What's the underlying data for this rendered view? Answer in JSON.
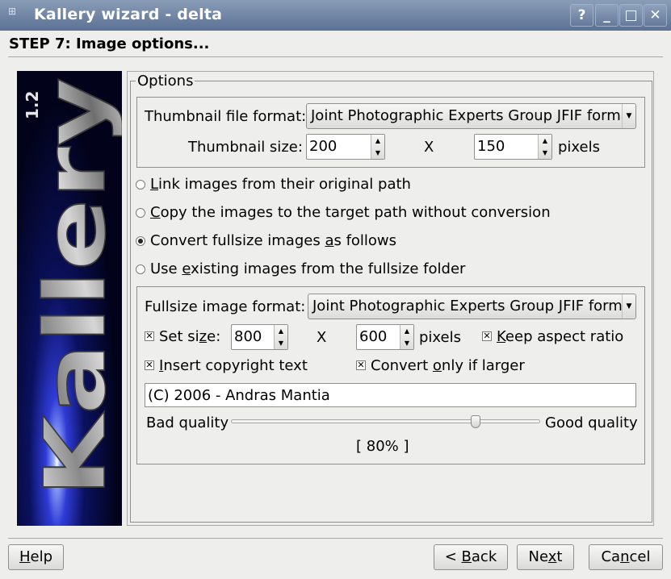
{
  "window": {
    "title": "Kallery wizard - delta",
    "help_icon": "question-mark-icon",
    "minimize_icon": "minimize-icon",
    "maximize_icon": "maximize-icon",
    "close_icon": "close-icon"
  },
  "step_title": "STEP 7: Image options...",
  "banner": {
    "logo_text": "Kallery",
    "version": "1.2"
  },
  "options": {
    "group_label": "Options",
    "thumbnail": {
      "format_label": "Thumbnail file format:",
      "format_value": "Joint Photographic Experts Group JFIF format",
      "size_label": "Thumbnail size:",
      "width": "200",
      "x_label": "X",
      "height": "150",
      "unit": "pixels"
    },
    "radios": {
      "link_pre": "",
      "link_ul": "L",
      "link_post": "ink images from their original path",
      "copy_pre": "",
      "copy_ul": "C",
      "copy_post": "opy the images to the target path without conversion",
      "convert_pre": "Convert fullsize images ",
      "convert_ul": "a",
      "convert_post": "s follows",
      "existing_pre": "Use ",
      "existing_ul": "e",
      "existing_post": "xisting images from the fullsize folder",
      "selected": "convert"
    },
    "fullsize": {
      "format_label": "Fullsize image format:",
      "format_value": "Joint Photographic Experts Group JFIF format",
      "set_size_pre": "Set si",
      "set_size_ul": "z",
      "set_size_post": "e:",
      "set_size_checked": true,
      "width": "800",
      "x_label": "X",
      "height": "600",
      "unit": "pixels",
      "keep_pre": "",
      "keep_ul": "K",
      "keep_post": "eep aspect ratio",
      "keep_checked": true,
      "copyright_pre": "",
      "copyright_ul": "I",
      "copyright_post": "nsert copyright text",
      "copyright_checked": true,
      "larger_pre": "Convert ",
      "larger_ul": "o",
      "larger_post": "nly if larger",
      "larger_checked": true,
      "copyright_text": "(C) 2006 - Andras Mantia",
      "bad_quality": "Bad quality",
      "good_quality": "Good quality",
      "quality_percent": 80,
      "quality_label": "[ 80% ]"
    }
  },
  "buttons": {
    "help_ul": "H",
    "help_post": "elp",
    "back_pre": "< ",
    "back_ul": "B",
    "back_post": "ack",
    "next_pre": "Ne",
    "next_ul": "x",
    "next_post": "t",
    "cancel_pre": "Ca",
    "cancel_ul": "n",
    "cancel_post": "cel"
  }
}
